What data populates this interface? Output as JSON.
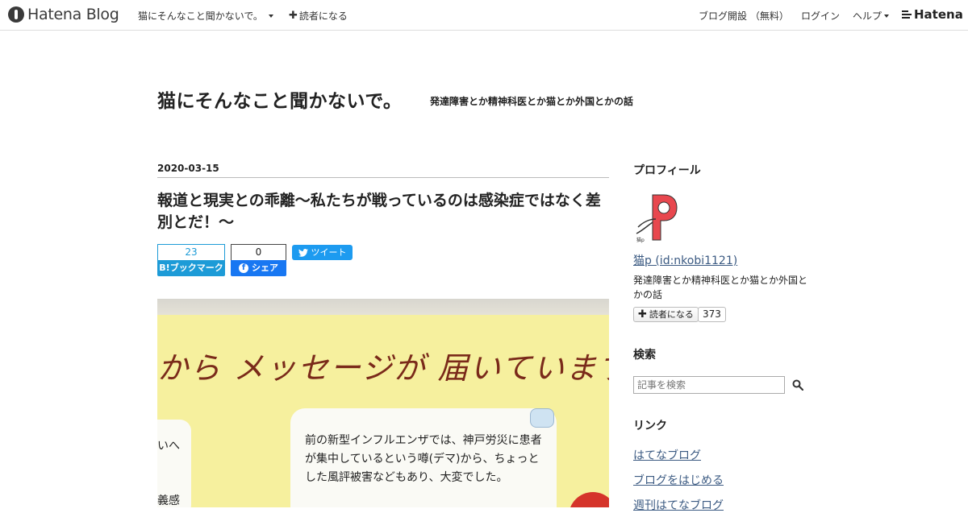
{
  "globalbar": {
    "logo_text": "Hatena Blog",
    "blog_name": "猫にそんなこと聞かないで。",
    "subscribe_label": "読者になる",
    "open_blog_label": "ブログ開設 （無料）",
    "login_label": "ログイン",
    "help_label": "ヘルプ",
    "hatena_label": "Hatena"
  },
  "header": {
    "title": "猫にそんなこと聞かないで。",
    "description": "発達障害とか精神科医とか猫とか外国とかの話"
  },
  "entry": {
    "date": "2020-03-15",
    "title": "報道と現実との乖離～私たちが戦っているのは感染症ではなく差別とだ！～",
    "share": {
      "hatena_count": "23",
      "hatena_label": "B!ブックマーク",
      "facebook_count": "0",
      "facebook_label": "シェア",
      "twitter_label": "ツイート"
    },
    "photo": {
      "headline": "から メッセージが 届いています",
      "card_text": "前の新型インフルエンザでは、神戸労災に患者が集中しているという噂(デマ)から、ちょっとした風評被害などもあり、大変でした。",
      "left_text_1": "いへ",
      "left_text_2": "義感"
    }
  },
  "sidebar": {
    "profile_heading": "プロフィール",
    "profile_name": "猫p (id:nkobi1121)",
    "profile_desc": "発達障害とか精神科医とか猫とか外国とかの話",
    "subscribe_label": "読者になる",
    "subscriber_count": "373",
    "search_heading": "検索",
    "search_placeholder": "記事を検索",
    "links_heading": "リンク",
    "links": [
      "はてなブログ",
      "ブログをはじめる",
      "週刊はてなブログ"
    ]
  },
  "colors": {
    "hatena_blue": "#1d9bd7",
    "facebook_blue": "#1877f2",
    "twitter_blue": "#1d9bf0",
    "link_color": "#3b5a82"
  }
}
